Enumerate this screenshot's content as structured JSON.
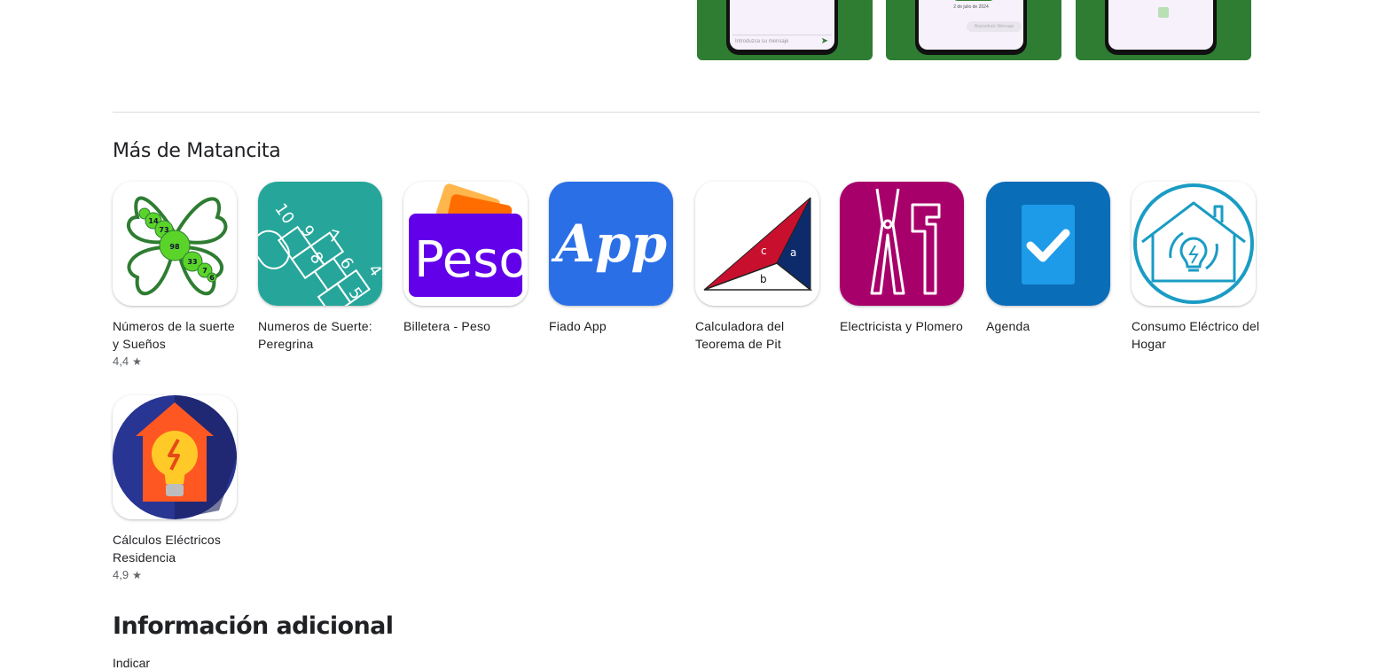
{
  "screenshots": {
    "message_placeholder": "Introduzca su mensaje",
    "date_label": "2 de julio de 2024",
    "action_label": "Reproducir Mensaje"
  },
  "more_from_developer": {
    "title": "Más de Matancita",
    "apps": [
      {
        "name": "Números de la suerte y Sueños",
        "rating": "4,4"
      },
      {
        "name": "Numeros de Suerte: Peregrina",
        "rating": ""
      },
      {
        "name": "Billetera - Peso",
        "rating": ""
      },
      {
        "name": "Fiado App",
        "rating": ""
      },
      {
        "name": "Calculadora del Teorema de Pit",
        "rating": ""
      },
      {
        "name": "Electricista y Plomero",
        "rating": ""
      },
      {
        "name": "Agenda",
        "rating": ""
      },
      {
        "name": "Consumo Eléctrico del Hogar",
        "rating": ""
      },
      {
        "name": "Cálculos Eléctricos Residencia",
        "rating": "4,9"
      }
    ]
  },
  "icons": {
    "clover_numbers": [
      "14",
      "73",
      "98",
      "33",
      "7",
      "6"
    ],
    "hopscotch_numbers": [
      "10",
      "9",
      "7",
      "8",
      "6",
      "5",
      "4"
    ],
    "peso_text": "Peso",
    "app_text": "App",
    "triangle_labels": [
      "c",
      "a",
      "b"
    ]
  },
  "additional_info": {
    "title": "Información adicional",
    "first_label": "Indicar"
  },
  "colors": {
    "screenshot_bg": "#2e7d32",
    "peregrina_bg": "#26a69a",
    "peso_bg": "#6200ea",
    "fiado_bg": "#2a6fe6",
    "plomero_bg": "#a8006a",
    "agenda_bg": "#0a6db8",
    "consumo_ring": "#1a9cc4"
  }
}
